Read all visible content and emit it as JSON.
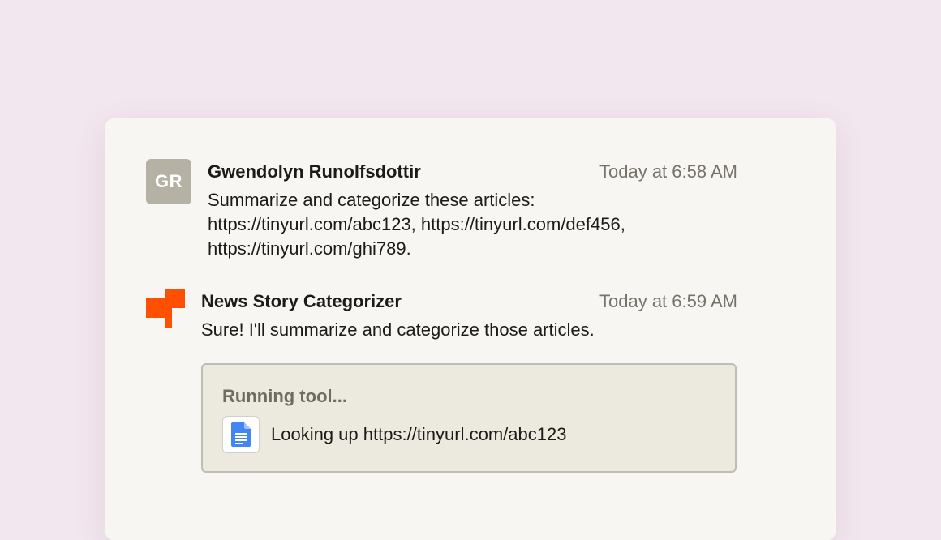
{
  "messages": {
    "user": {
      "initials": "GR",
      "name": "Gwendolyn Runolfsdottir",
      "time": "Today at 6:58 AM",
      "text": "Summarize and categorize these articles: https://tinyurl.com/abc123, https://tinyurl.com/def456, https://tinyurl.com/ghi789.",
      "avatar_color": "#b5b1a5"
    },
    "bot": {
      "name": "News Story Categorizer",
      "time": "Today at 6:59 AM",
      "text": "Sure! I'll summarize and categorize those articles.",
      "logo_color": "#ff4f00"
    }
  },
  "tool": {
    "title": "Running tool...",
    "icon": "google-docs-icon",
    "action": "Looking up https://tinyurl.com/abc123"
  },
  "colors": {
    "background": "#f2e6ef",
    "card": "#f8f6f3",
    "tool_box": "#ece9df",
    "doc_blue": "#4285f4"
  }
}
